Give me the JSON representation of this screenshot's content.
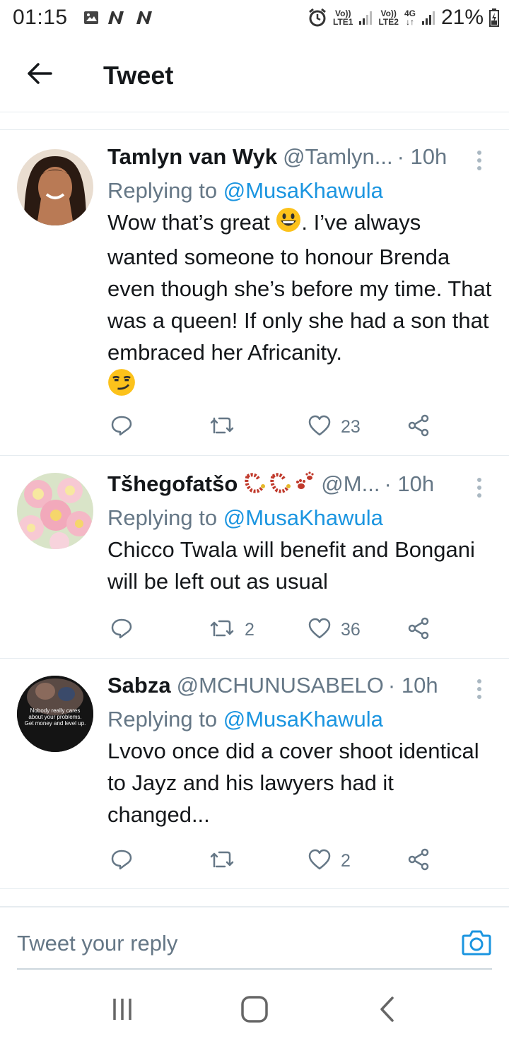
{
  "status_bar": {
    "time": "01:15",
    "net1_top": "Vo))",
    "net1_bottom": "LTE1",
    "net2_top": "Vo))",
    "net2_bottom": "LTE2",
    "net_type": "4G",
    "battery": "21%",
    "icons": [
      "image-icon",
      "notification-n-icon",
      "notification-n-icon",
      "alarm-icon",
      "signal-icon",
      "battery-icon"
    ]
  },
  "header": {
    "title": "Tweet",
    "back_icon": "arrow-left-icon"
  },
  "tweets": [
    {
      "name": "Tamlyn van Wyk",
      "handle": "@Tamlyn...",
      "time": "· 10h",
      "replying_prefix": "Replying to ",
      "replying_to": "@MusaKhawula",
      "text_part1": "Wow that’s great ",
      "text_part2": ". I’ve always wanted someone to honour Brenda even though she’s before my time. That was a queen! If only she had a son that embraced her Africanity.",
      "retweets": "",
      "likes": "23"
    },
    {
      "name": "Tšhegofatšo",
      "handle": "@M...",
      "time": "· 10h",
      "replying_prefix": "Replying to ",
      "replying_to": "@MusaKhawula",
      "text": "Chicco Twala will benefit and Bongani will be left out as usual",
      "retweets": "2",
      "likes": "36"
    },
    {
      "name": "Sabza",
      "handle": "@MCHUNUSABELO",
      "time": "· 10h",
      "replying_prefix": "Replying to ",
      "replying_to": "@MusaKhawula",
      "avatar_text": "Nobody really cares about your problems. Get money and level up.",
      "text": "Lvovo once did a cover shoot identical to Jayz and his lawyers had it changed...",
      "retweets": "",
      "likes": "2"
    }
  ],
  "reply_bar": {
    "placeholder": "Tweet your reply"
  },
  "colors": {
    "accent": "#1b95e0",
    "secondary_text": "#657786",
    "primary_text": "#14171a",
    "divider": "#e6ecf0"
  }
}
